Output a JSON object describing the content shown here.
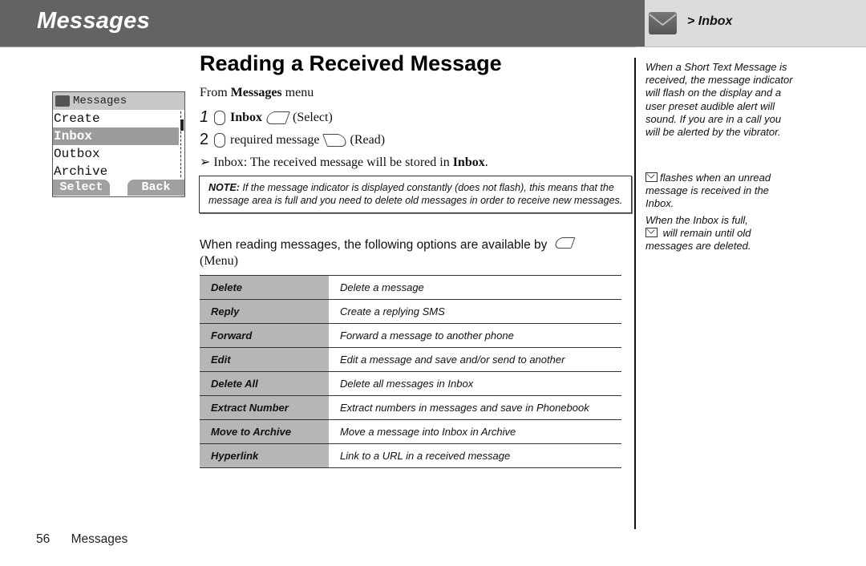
{
  "header": {
    "chapter_title": "Messages",
    "section_breadcrumb": "> Inbox",
    "section_icon": "envelope-icon"
  },
  "phone_screen": {
    "title": "Messages",
    "items": [
      "Create",
      "Inbox",
      "Outbox",
      "Archive"
    ],
    "selected": "Inbox",
    "softkeys": {
      "left": "Select",
      "right": "Back"
    }
  },
  "main": {
    "title": "Reading a Received Message",
    "from_prefix": "From ",
    "from_menu": "Messages",
    "from_suffix": " menu",
    "steps": [
      {
        "num": "1",
        "target": "Inbox",
        "action": "(Select)"
      },
      {
        "num": "2",
        "target": "required message",
        "action": "(Read)"
      }
    ],
    "result_prefix": "➢ Inbox: The received message will be stored in ",
    "result_bold": "Inbox",
    "result_suffix": ".",
    "note_label": "NOTE:",
    "note_text": " If the message indicator is displayed constantly (does not flash), this means that the message area is full and you need to delete old messages in order to receive new messages.",
    "options_intro": "When reading messages, the following options are available by",
    "options_intro_menu": "(Menu)",
    "options": [
      {
        "name": "Delete",
        "desc": "Delete a message"
      },
      {
        "name": "Reply",
        "desc": "Create a replying SMS"
      },
      {
        "name": "Forward",
        "desc": "Forward a message to another phone"
      },
      {
        "name": "Edit",
        "desc": "Edit a message and save and/or send to another"
      },
      {
        "name": "Delete All",
        "desc": "Delete all messages in Inbox"
      },
      {
        "name": "Extract Number",
        "desc": "Extract numbers in messages and save in Phonebook"
      },
      {
        "name": "Move to Archive",
        "desc": "Move a message into Inbox in Archive"
      },
      {
        "name": "Hyperlink",
        "desc": "Link to a URL in a received message"
      }
    ]
  },
  "sidebar": {
    "para1": "When a Short Text Message is received, the message indicator will flash on the display and a user preset audible alert will sound. If you are in a call you will be alerted by the vibrator.",
    "para2": "flashes when an unread message is received in the Inbox.",
    "para3_a": "When the Inbox is full,",
    "para3_b": " will remain until old messages are deleted."
  },
  "footer": {
    "page_number": "56",
    "section": "Messages"
  }
}
